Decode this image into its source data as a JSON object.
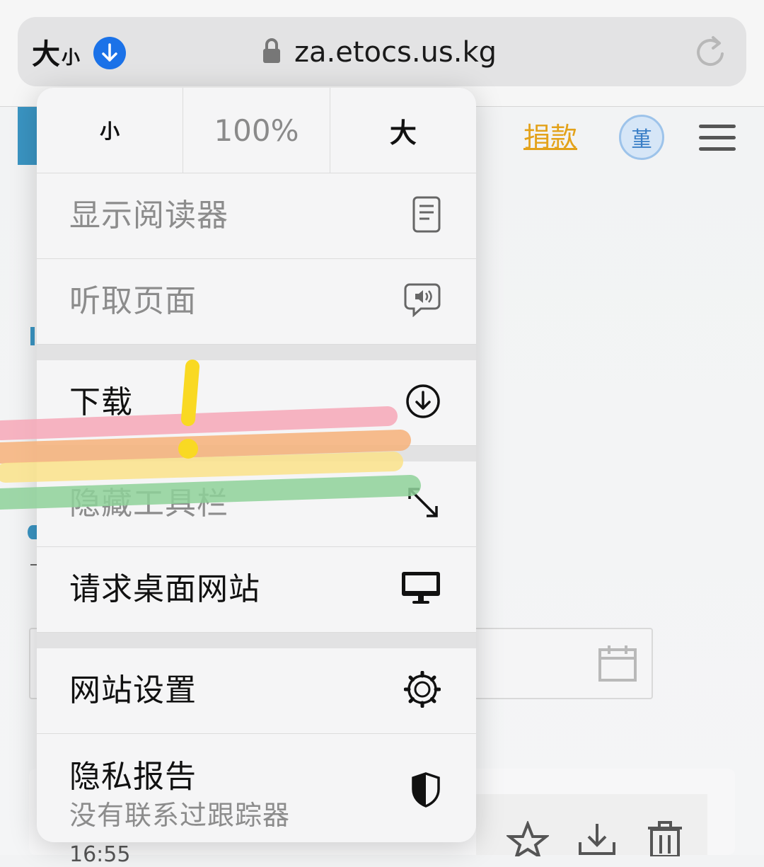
{
  "address_bar": {
    "aa_big": "大",
    "aa_small": "小",
    "url": "za.etocs.us.kg"
  },
  "page": {
    "donate_link": "捐款",
    "avatar_char": "堇",
    "time_partial": "16:55"
  },
  "popup": {
    "zoom": {
      "smaller_label": "小",
      "percent": "100%",
      "larger_label": "大"
    },
    "items": [
      {
        "label": "显示阅读器",
        "icon": "reader-icon",
        "enabled": false
      },
      {
        "label": "听取页面",
        "icon": "speaker-bubble-icon",
        "enabled": false
      },
      {
        "label": "下载",
        "icon": "download-circle-icon",
        "enabled": true
      },
      {
        "label": "隐藏工具栏",
        "icon": "expand-arrows-icon",
        "enabled": false
      },
      {
        "label": "请求桌面网站",
        "icon": "desktop-icon",
        "enabled": true
      },
      {
        "label": "网站设置",
        "icon": "gear-icon",
        "enabled": true
      },
      {
        "label": "隐私报告",
        "sublabel": "没有联系过跟踪器",
        "icon": "shield-icon",
        "enabled": true
      }
    ]
  },
  "colors": {
    "accent_blue": "#1b72e8",
    "donate_gold": "#e3a21a",
    "rainbow": [
      "#f7a8b8",
      "#f7b27a",
      "#fbe38a",
      "#8fd29a"
    ],
    "highlight_yellow": "#f9d923"
  }
}
